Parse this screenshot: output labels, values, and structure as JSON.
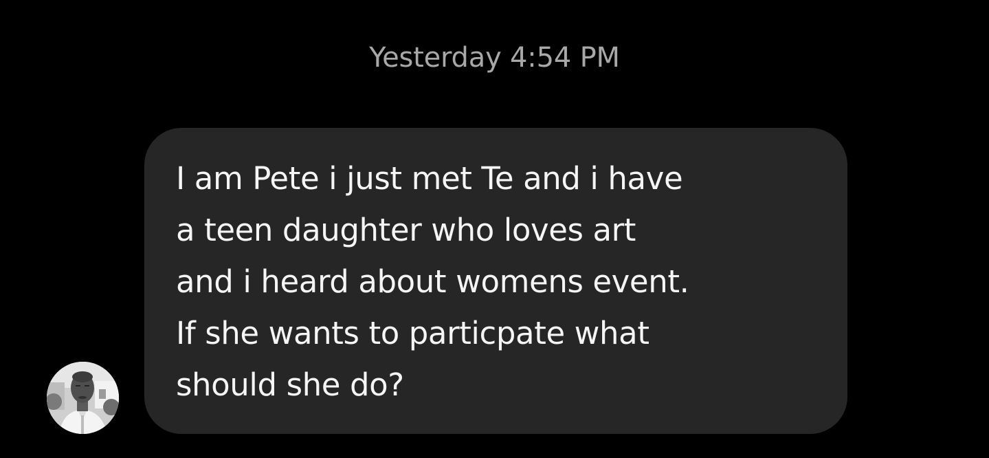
{
  "conversation": {
    "timestamp": "Yesterday 4:54 PM",
    "messages": [
      {
        "sender_avatar": "user-avatar-photo",
        "text": "I am Pete i just met Te and i have\na teen daughter who loves art\nand i heard about womens event.\nIf she wants to particpate what\nshould she do?"
      }
    ]
  },
  "colors": {
    "background": "#000000",
    "bubble": "#262626",
    "message_text": "#f5f5f5",
    "timestamp_text": "#a8a8a8"
  }
}
